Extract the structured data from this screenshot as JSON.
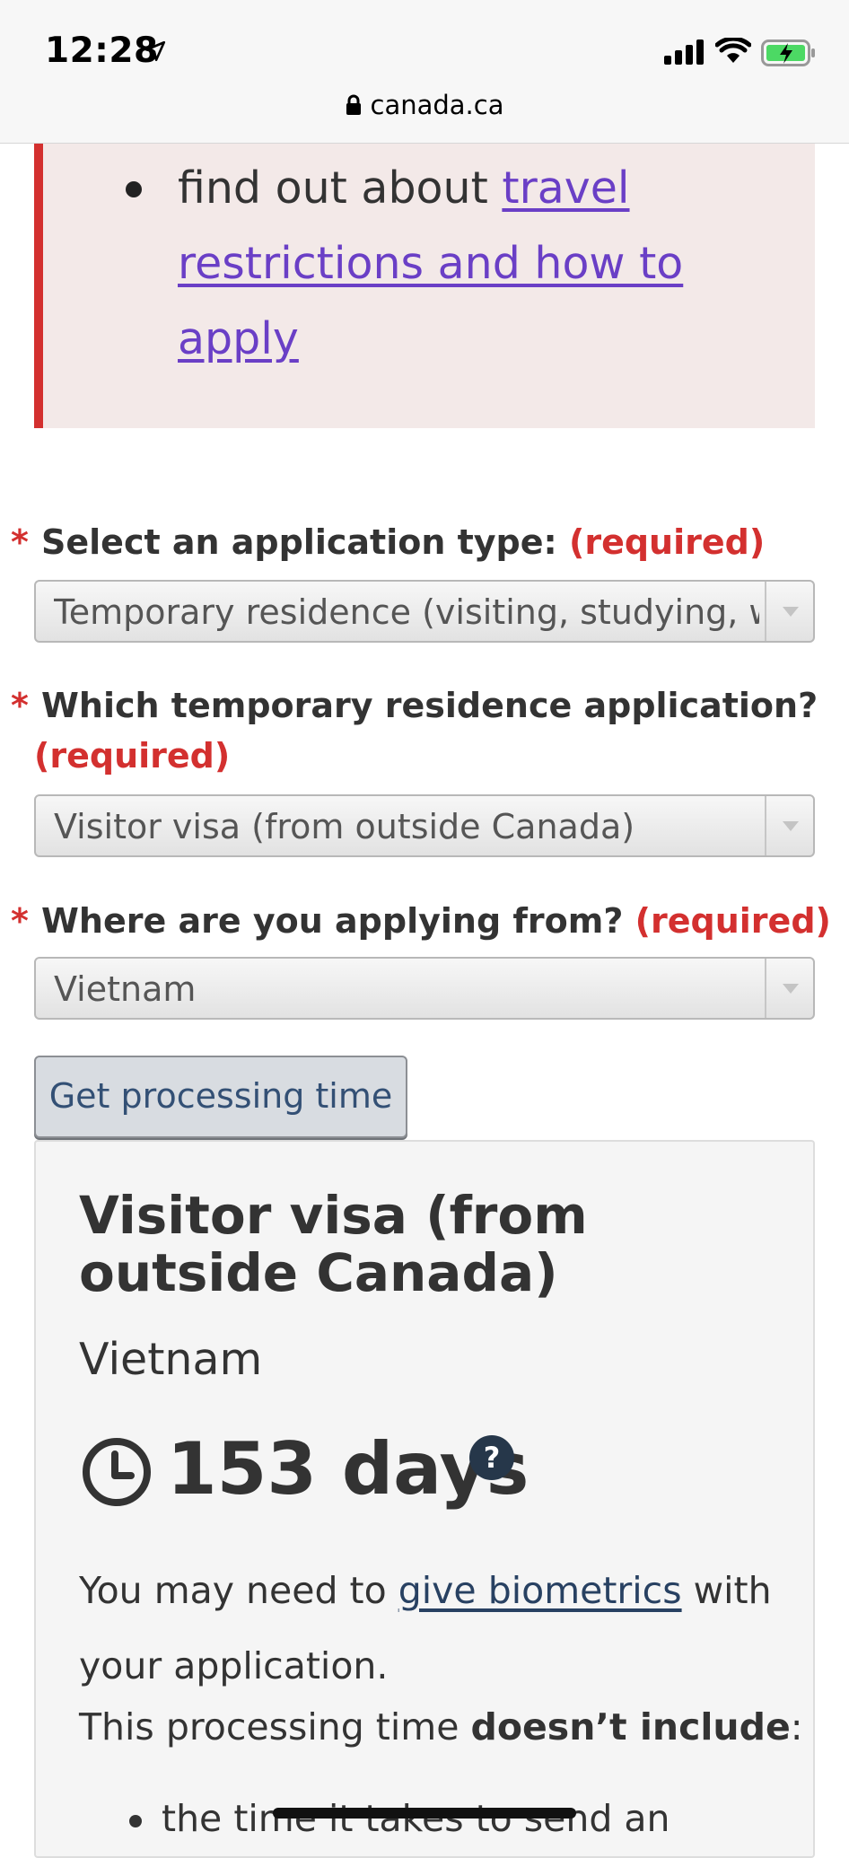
{
  "status_bar": {
    "time": "12:28"
  },
  "browser": {
    "url": "canada.ca"
  },
  "alert": {
    "text": "find out about ",
    "link": "travel restrictions and how to apply"
  },
  "form": {
    "application_type": {
      "label": "Select an application type:",
      "required": "(required)",
      "value": "Temporary residence (visiting, studying, working)"
    },
    "temp_residence": {
      "label": "Which temporary residence application?",
      "required": "(required)",
      "value": "Visitor visa (from outside Canada)"
    },
    "applying_from": {
      "label": "Where are you applying from?",
      "required": "(required)",
      "value": "Vietnam"
    },
    "submit_label": "Get processing time"
  },
  "result": {
    "title": "Visitor visa (from outside Canada)",
    "country": "Vietnam",
    "processing_time": "153 days",
    "biometrics_pre": "You may need to ",
    "biometrics_link": "give biometrics",
    "biometrics_post": " with your application.",
    "note_pre": "This processing time ",
    "note_bold": "doesn’t include",
    "note_post": ":",
    "list_first_visible": "the time it takes to send an"
  },
  "colors": {
    "required_red": "#d3302f",
    "link_visited_purple": "#6a3fc6",
    "link_blue": "#284162",
    "button_text": "#335075"
  }
}
